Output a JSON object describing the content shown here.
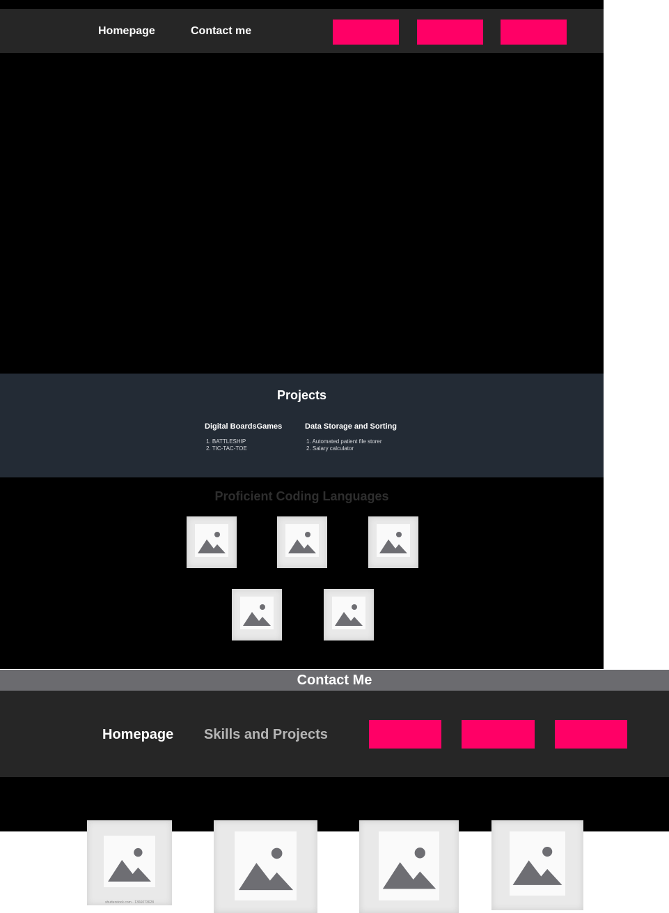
{
  "top_page": {
    "nav": {
      "home_label": "Homepage",
      "contact_label": "Contact me"
    },
    "projects": {
      "title": "Projects",
      "columns": [
        {
          "title": "Digital BoardsGames",
          "items": [
            "1. BATTLESHIP",
            "2. TIC-TAC-TOE"
          ]
        },
        {
          "title": "Data Storage and Sorting",
          "items": [
            "1. Automated patient file storer",
            "2. Salary calculator"
          ]
        }
      ]
    },
    "languages": {
      "title": "Proficient Coding Languages",
      "image_icon": "image-placeholder-icon"
    }
  },
  "bottom_page": {
    "header_title": "Contact Me",
    "nav": {
      "home_label": "Homepage",
      "skills_label": "Skills and Projects"
    },
    "images": [
      {
        "icon": "image-placeholder-icon",
        "caption": "shutterstock.com · 1366073628"
      }
    ]
  },
  "colors": {
    "accent_pink": "#ff0066",
    "nav_bg": "#262626",
    "projects_bg": "#232b35",
    "contact_bar_bg": "#6b6b6f",
    "placeholder_grey": "#6e6e73"
  }
}
